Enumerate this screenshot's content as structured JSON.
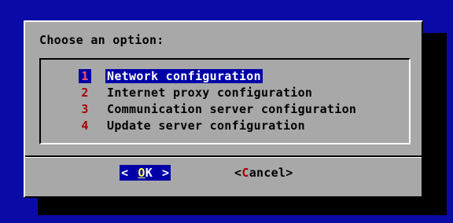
{
  "dialog": {
    "prompt": "Choose an option:"
  },
  "menu": {
    "items": [
      {
        "key": "1",
        "label": "Network configuration",
        "selected": true
      },
      {
        "key": "2",
        "label": "Internet proxy configuration",
        "selected": false
      },
      {
        "key": "3",
        "label": "Communication server configuration",
        "selected": false
      },
      {
        "key": "4",
        "label": "Update server configuration",
        "selected": false
      }
    ]
  },
  "buttons": {
    "ok": {
      "open": "<",
      "hotkey": "O",
      "rest": "K",
      "close": ">"
    },
    "cancel": {
      "open": "<",
      "hotkey": "C",
      "rest": "ancel",
      "close": ">"
    }
  },
  "colors": {
    "background": "#0000a8",
    "dialog": "#a8a8a8",
    "selected_bg": "#0000a8",
    "hotkey": "#a80000",
    "ok_hotkey": "#ffff55"
  }
}
